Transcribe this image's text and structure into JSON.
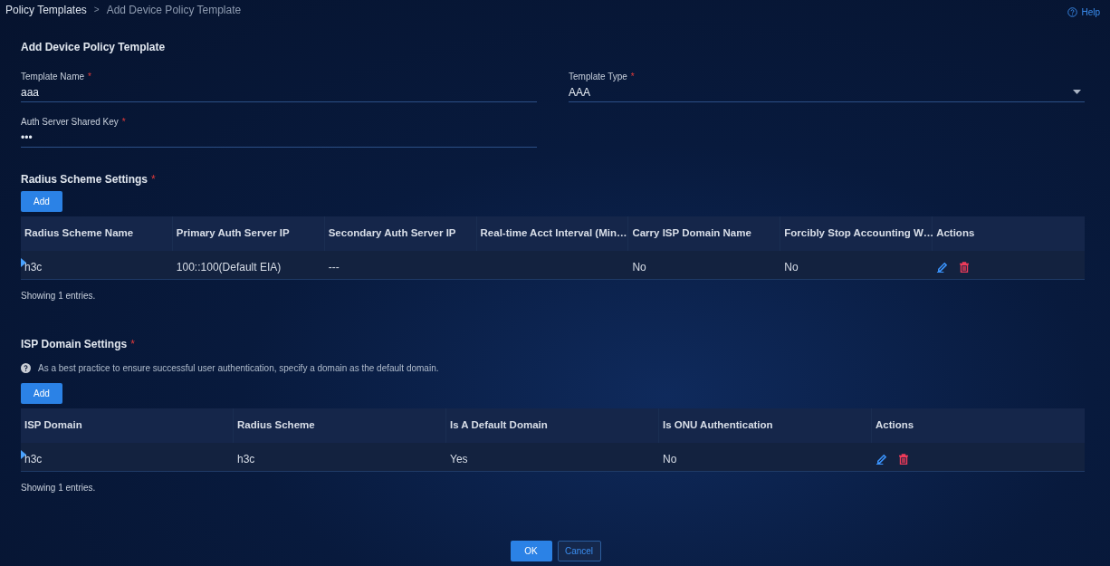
{
  "breadcrumb": {
    "items": [
      "Policy Templates",
      "Add Device Policy Template"
    ],
    "separator": ">"
  },
  "help": "Help",
  "title": "Add Device Policy Template",
  "fields": [
    {
      "kind": "text",
      "label": "Template Name",
      "required_mark": "*",
      "value": "aaa"
    },
    {
      "kind": "select",
      "label": "Template Type",
      "required_mark": "*",
      "value": "AAA"
    },
    {
      "kind": "password",
      "label": "Auth Server Shared Key",
      "required_mark": "*",
      "value": "•••"
    }
  ],
  "sections": [
    {
      "title": "Radius Scheme Settings",
      "required_mark": "*",
      "add_button": "Add",
      "table": {
        "columns": [
          "Radius Scheme Name",
          "Primary Auth Server IP",
          "Secondary Auth Server IP",
          "Real-time Acct Interval (Min…",
          "Carry ISP Domain Name",
          "Forcibly Stop Accounting W…",
          "Actions"
        ],
        "rows": [
          {
            "selected": true,
            "cells": [
              "h3c",
              "100::100(Default EIA)",
              "---",
              "",
              "No",
              "No"
            ]
          }
        ]
      },
      "footer": "Showing 1 entries."
    },
    {
      "title": "ISP Domain Settings",
      "required_mark": "*",
      "hint": "As a best practice to ensure successful user authentication, specify a domain as the default domain.",
      "add_button": "Add",
      "table": {
        "columns": [
          "ISP Domain",
          "Radius Scheme",
          "Is A Default Domain",
          "Is ONU Authentication",
          "Actions"
        ],
        "rows": [
          {
            "selected": true,
            "cells": [
              "h3c",
              "h3c",
              "Yes",
              "No"
            ]
          }
        ]
      },
      "footer": "Showing 1 entries."
    }
  ],
  "buttons": [
    {
      "label": "OK",
      "kind": "primary"
    },
    {
      "label": "Cancel",
      "kind": "secondary"
    }
  ]
}
